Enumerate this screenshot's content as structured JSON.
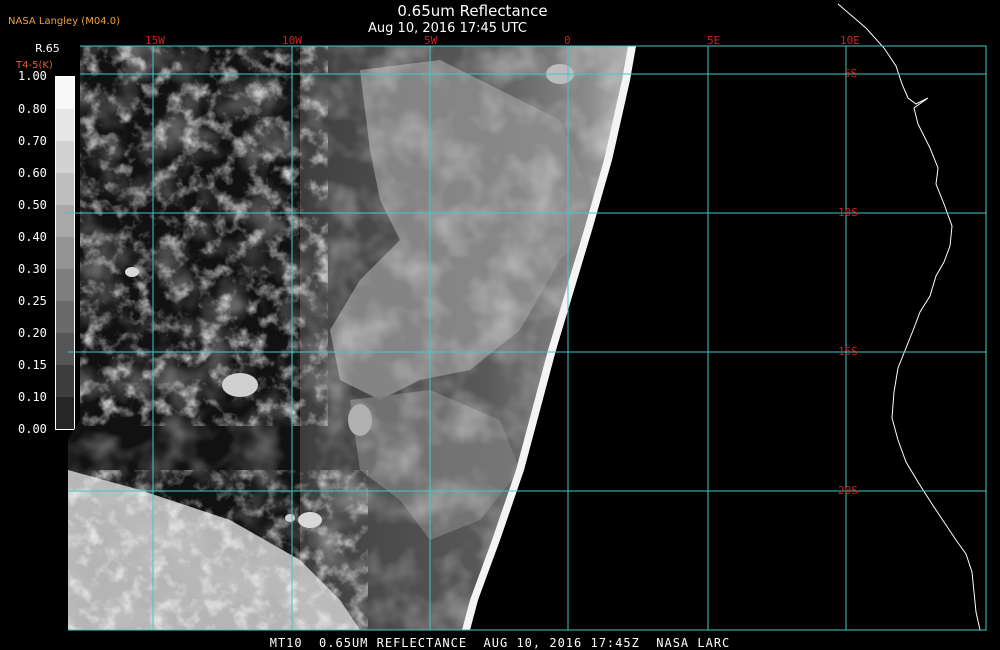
{
  "header": {
    "credit": "NASA Langley (M04.0)",
    "title": "0.65um Reflectance",
    "subtitle": "Aug 10, 2016 17:45 UTC"
  },
  "scale": {
    "title": "R.65",
    "subtitle": "T4-5(K)",
    "ticks": [
      "1.00",
      "0.80",
      "0.70",
      "0.60",
      "0.50",
      "0.40",
      "0.30",
      "0.25",
      "0.20",
      "0.15",
      "0.10",
      "0.00"
    ]
  },
  "grid": {
    "longitudes": [
      "15W",
      "10W",
      "5W",
      "0",
      "5E",
      "10E"
    ],
    "latitudes": [
      "5S",
      "10S",
      "15S",
      "20S"
    ],
    "line_color": "#40c8c8",
    "label_color": "#d02020"
  },
  "footer": {
    "text": "MT10  0.65UM REFLECTANCE  AUG 10, 2016 17:45Z  NASA LARC"
  }
}
